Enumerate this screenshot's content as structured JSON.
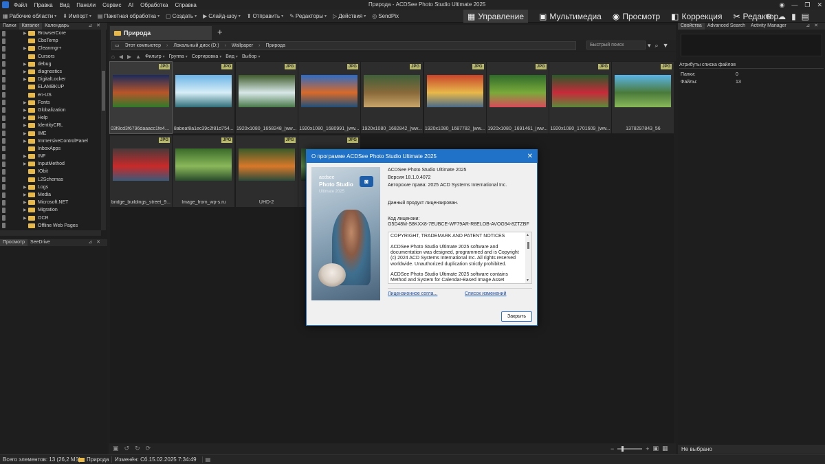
{
  "window": {
    "title": "Природа - ACDSee Photo Studio Ultimate 2025"
  },
  "menu": [
    "Файл",
    "Правка",
    "Вид",
    "Панели",
    "Сервис",
    "AI",
    "Обработка",
    "Справка"
  ],
  "toolbar": {
    "tools": [
      {
        "label": "Рабочие области",
        "icon": "grid-icon"
      },
      {
        "label": "Импорт",
        "icon": "import-icon"
      },
      {
        "label": "Пакетная обработка",
        "icon": "batch-icon"
      },
      {
        "label": "Создать",
        "icon": "create-icon"
      },
      {
        "label": "Слайд-шоу",
        "icon": "slideshow-icon"
      },
      {
        "label": "Отправить",
        "icon": "send-icon"
      },
      {
        "label": "Редакторы",
        "icon": "editors-icon"
      },
      {
        "label": "Действия",
        "icon": "actions-icon"
      },
      {
        "label": "SendPix",
        "icon": "sendpix-icon"
      }
    ],
    "modes": [
      {
        "label": "Управление",
        "icon": "manage-icon",
        "active": true
      },
      {
        "label": "Мультимедиа",
        "icon": "media-icon",
        "active": false
      },
      {
        "label": "Просмотр",
        "icon": "eye-icon",
        "active": false
      },
      {
        "label": "Коррекция",
        "icon": "develop-icon",
        "active": false
      },
      {
        "label": "Редактор",
        "icon": "edit-tools-icon",
        "active": false
      }
    ]
  },
  "left_panel": {
    "tabs": [
      "Папки",
      "Каталог",
      "Календарь"
    ],
    "folders": [
      {
        "name": "BrowserCore",
        "expandable": true
      },
      {
        "name": "CbsTemp",
        "expandable": false
      },
      {
        "name": "Cleanmgr+",
        "expandable": true
      },
      {
        "name": "Cursors",
        "expandable": false
      },
      {
        "name": "debug",
        "expandable": true
      },
      {
        "name": "diagnostics",
        "expandable": true
      },
      {
        "name": "DigitalLocker",
        "expandable": true
      },
      {
        "name": "ELAMBKUP",
        "expandable": false
      },
      {
        "name": "en-US",
        "expandable": false
      },
      {
        "name": "Fonts",
        "expandable": true
      },
      {
        "name": "Globalization",
        "expandable": true
      },
      {
        "name": "Help",
        "expandable": true
      },
      {
        "name": "IdentityCRL",
        "expandable": true
      },
      {
        "name": "IME",
        "expandable": true
      },
      {
        "name": "ImmersiveControlPanel",
        "expandable": true
      },
      {
        "name": "InboxApps",
        "expandable": false
      },
      {
        "name": "INF",
        "expandable": true
      },
      {
        "name": "InputMethod",
        "expandable": true
      },
      {
        "name": "IObit",
        "expandable": false
      },
      {
        "name": "L2Schemas",
        "expandable": false
      },
      {
        "name": "Logs",
        "expandable": true
      },
      {
        "name": "Media",
        "expandable": true
      },
      {
        "name": "Microsoft.NET",
        "expandable": true
      },
      {
        "name": "Migration",
        "expandable": true
      },
      {
        "name": "OCR",
        "expandable": true
      },
      {
        "name": "Offline Web Pages",
        "expandable": false
      }
    ],
    "preview_tabs": [
      "Просмотр",
      "SeeDrive"
    ]
  },
  "tabs": {
    "current": "Природа",
    "add": "+"
  },
  "address": {
    "crumbs": [
      "Этот компьютер",
      "Локальный диск (D:)",
      "Wallpaper",
      "Природа"
    ],
    "search_placeholder": "Быстрый поиск"
  },
  "filters": [
    "Фильтр",
    "Группа",
    "Сортировка",
    "Вид",
    "Выбор"
  ],
  "thumbnails": [
    {
      "caption": "03f8cd3f6796daaacc1fe43...",
      "badge": "JPG",
      "colors": [
        "#1b2a5c",
        "#b8552a",
        "#2f7a2a"
      ],
      "selected": true
    },
    {
      "caption": "8abeaf8a1ec39c2f81d754...",
      "badge": "JPG",
      "colors": [
        "#6bb4e6",
        "#d7eef7",
        "#2f6f7a"
      ],
      "selected": false
    },
    {
      "caption": "1920x1080_1658248_[ww...",
      "badge": "JPG",
      "colors": [
        "#3f5a2a",
        "#d8e8e8",
        "#4a7a4a"
      ],
      "selected": false
    },
    {
      "caption": "1920x1080_1680991_[ww...",
      "badge": "JPG",
      "colors": [
        "#2d6bc4",
        "#d86a2a",
        "#1f4f7a"
      ],
      "selected": false
    },
    {
      "caption": "1920x1080_1682842_[ww...",
      "badge": "JPG",
      "colors": [
        "#3f5f3a",
        "#8a6a3a",
        "#c8a56a"
      ],
      "selected": false
    },
    {
      "caption": "1920x1080_1687782_[ww...",
      "badge": "JPG",
      "colors": [
        "#c8442a",
        "#e8b84a",
        "#4a6a8a"
      ],
      "selected": false
    },
    {
      "caption": "1920x1080_1691461_[ww...",
      "badge": "JPG",
      "colors": [
        "#2f6a2a",
        "#7aaa3a",
        "#d84a5a"
      ],
      "selected": false
    },
    {
      "caption": "1920x1080_1701609_[ww...",
      "badge": "JPG",
      "colors": [
        "#2a5a2a",
        "#c82a3a",
        "#5a8a3a"
      ],
      "selected": false
    },
    {
      "caption": "1378297843_56",
      "badge": "JPG",
      "colors": [
        "#5ab4e8",
        "#4a7a3a",
        "#8ab85a"
      ],
      "selected": false
    },
    {
      "caption": "bridge_buildings_street_9...",
      "badge": "JPG",
      "colors": [
        "#4a3a3a",
        "#c82a2a",
        "#3a5a7a"
      ],
      "selected": false
    },
    {
      "caption": "Image_from_wp-s.ru",
      "badge": "JPG",
      "colors": [
        "#3a6a2a",
        "#8ab85a",
        "#2a4a2a"
      ],
      "selected": false
    },
    {
      "caption": "UHD-2",
      "badge": "JPG",
      "colors": [
        "#3a5a2a",
        "#d8782a",
        "#2a4a3a"
      ],
      "selected": false
    },
    {
      "caption": "",
      "badge": "JPG",
      "colors": [
        "#2a4a2a",
        "#5a8a4a",
        "#1a2a1a"
      ],
      "selected": false
    }
  ],
  "right_panel": {
    "tabs": [
      "Свойства",
      "Advanced Search",
      "Activity Manager"
    ],
    "attr_title": "Атрибуты списка файлов",
    "rows": [
      {
        "label": "Папки:",
        "value": "0"
      },
      {
        "label": "Файлы:",
        "value": "13"
      }
    ],
    "footer": "Не выбрано"
  },
  "statusbar": {
    "total": "Всего элементов: 13 (26,2 МБ)",
    "folder": "Природа",
    "modified": "Изменён: Сб.15.02.2025 7:34:49"
  },
  "dialog": {
    "title": "О программе ACDSee Photo Studio Ultimate 2025",
    "logo_line1": "acdsee",
    "logo_line2": "Photo Studio",
    "logo_line3": "Ultimate 2025",
    "product": "ACDSee Photo Studio Ultimate 2025",
    "version": "Версия 18.1.0.4072",
    "copyright": "Авторские права: 2025 ACD Systems International Inc.",
    "licensed": "Данный продукт лицензирован.",
    "license_label": "Код лицензии:",
    "license_code": "G5D48M-S8KXX8-7EUBCE-WF79AR-R8ELOB-AVOG94-8ZTZBF",
    "notice_title": "COPYRIGHT, TRADEMARK AND PATENT NOTICES",
    "notice_p1": "ACDSee Photo Studio Ultimate 2025 software and documentation was designed, programmed and is Copyright (c) 2024 ACD Systems International Inc. All rights reserved worldwide. Unauthorized duplication strictly prohibited.",
    "notice_p2": "ACDSee Photo Studio Ultimate 2025 software contains Method and System for Calendar-Based Image Asset Organization.",
    "link_license": "Лицензионное согла...",
    "link_changes": "Список изменений",
    "close_label": "Закрыть"
  }
}
